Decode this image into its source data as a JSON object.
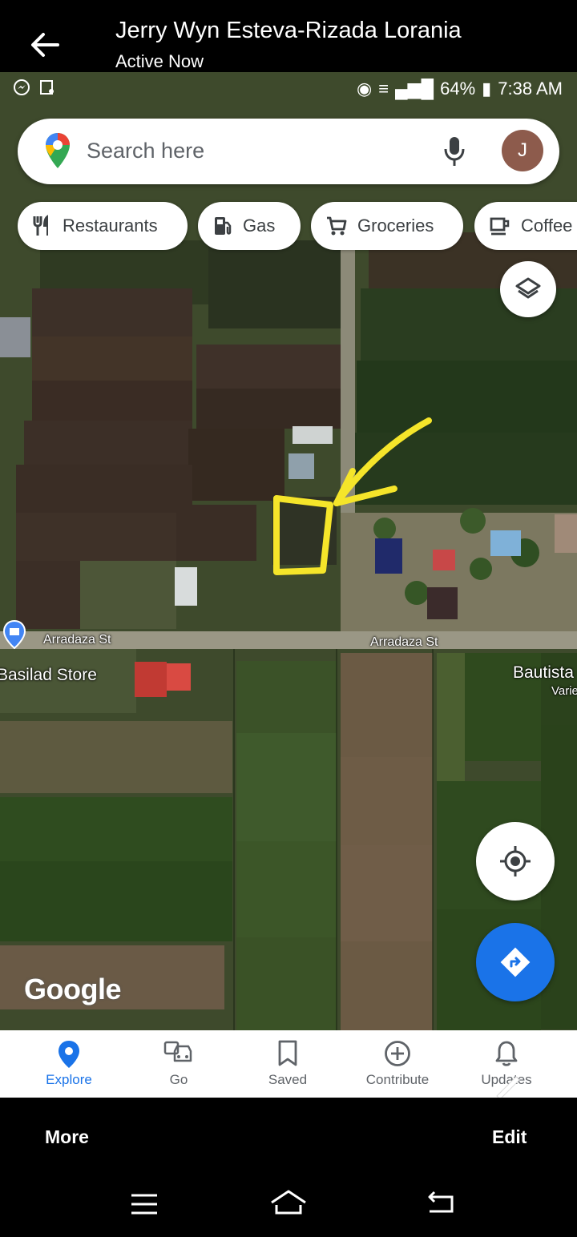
{
  "chat": {
    "title": "Jerry Wyn Esteva-Rizada Lorania",
    "subtitle": "Active Now"
  },
  "status_bar": {
    "battery": "64%",
    "time": "7:38 AM"
  },
  "search": {
    "placeholder": "Search here",
    "avatar_initial": "J"
  },
  "chips": [
    {
      "label": "Restaurants",
      "icon": "fork-knife-icon"
    },
    {
      "label": "Gas",
      "icon": "gas-pump-icon"
    },
    {
      "label": "Groceries",
      "icon": "cart-icon"
    },
    {
      "label": "Coffee",
      "icon": "coffee-cup-icon"
    }
  ],
  "map_labels": {
    "street_left": "Arradaza St",
    "street_right": "Arradaza St",
    "store": "Basilad Store",
    "place_right": "Bautista",
    "place_right_sub": "Varie"
  },
  "logo": "Google",
  "nav": [
    {
      "label": "Explore",
      "icon": "pin-icon",
      "active": true
    },
    {
      "label": "Go",
      "icon": "car-icon",
      "active": false
    },
    {
      "label": "Saved",
      "icon": "bookmark-icon",
      "active": false
    },
    {
      "label": "Contribute",
      "icon": "plus-circle-icon",
      "active": false
    },
    {
      "label": "Updates",
      "icon": "bell-icon",
      "active": false
    }
  ],
  "actions": {
    "more": "More",
    "edit": "Edit"
  },
  "colors": {
    "accent": "#1a73e8",
    "annotation": "#f5e52a"
  }
}
